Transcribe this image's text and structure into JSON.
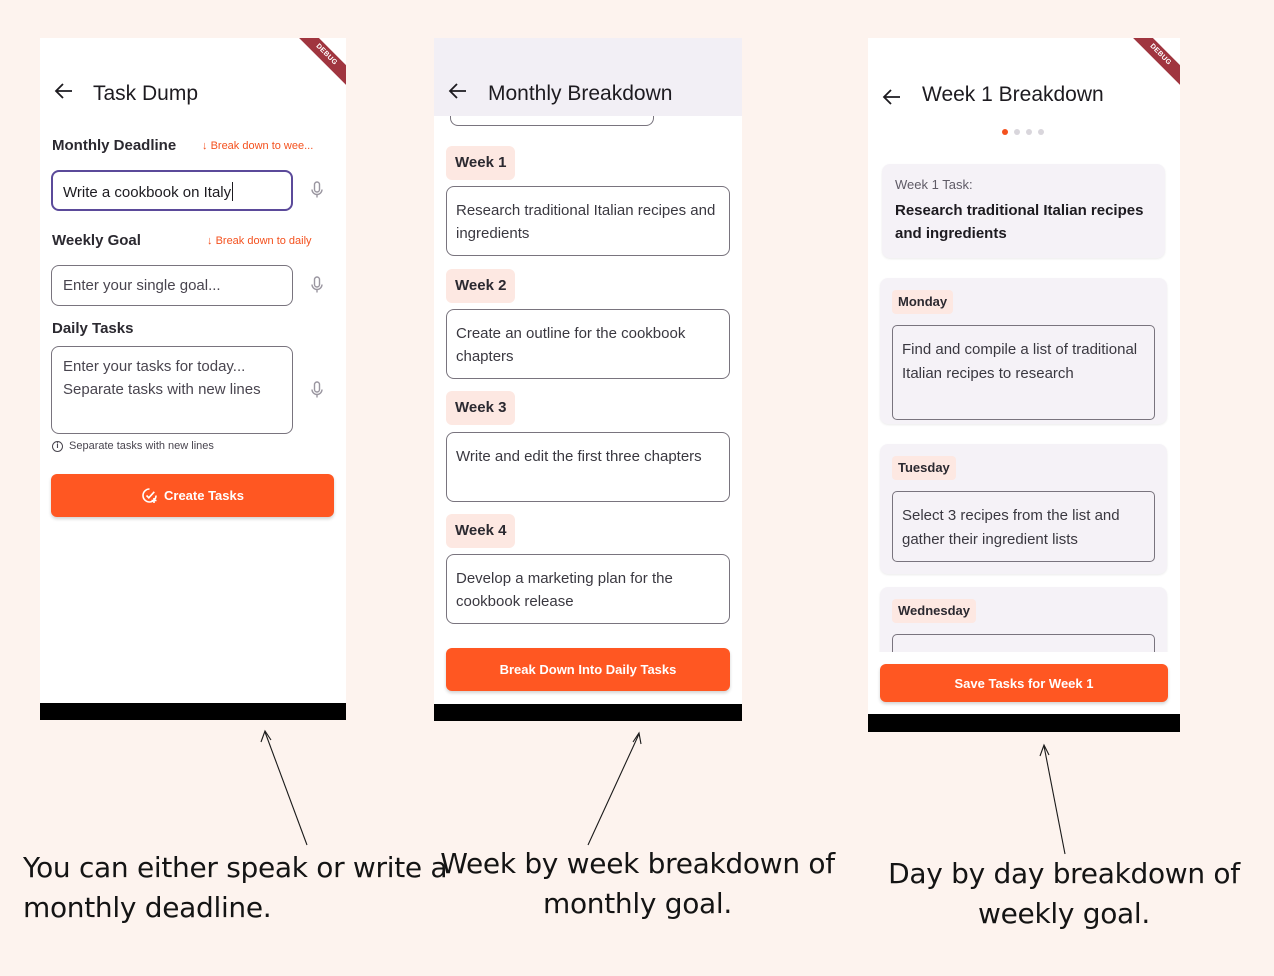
{
  "debug_banner": "DEBUG",
  "screen1": {
    "title": "Task Dump",
    "monthly_label": "Monthly Deadline",
    "monthly_link": "Break down to wee...",
    "monthly_value": "Write a cookbook on Italy",
    "weekly_label": "Weekly Goal",
    "weekly_link": "Break down to daily",
    "weekly_placeholder": "Enter your single goal...",
    "daily_label": "Daily Tasks",
    "daily_placeholder_line1": "Enter your tasks for today...",
    "daily_placeholder_line2": "Separate tasks with new lines",
    "hint": "Separate tasks with new lines",
    "button": "Create Tasks"
  },
  "screen2": {
    "title": "Monthly Breakdown",
    "weeks": [
      {
        "label": "Week 1",
        "task": "Research traditional Italian recipes and ingredients"
      },
      {
        "label": "Week 2",
        "task": "Create an outline for the cookbook chapters"
      },
      {
        "label": "Week 3",
        "task": "Write and edit the first three chapters"
      },
      {
        "label": "Week 4",
        "task": "Develop a marketing plan for the cookbook release"
      }
    ],
    "button": "Break Down Into Daily Tasks"
  },
  "screen3": {
    "title": "Week 1 Breakdown",
    "page_count": 4,
    "active_page": 1,
    "task_label": "Week 1 Task:",
    "task_text": "Research traditional Italian recipes and ingredients",
    "days": [
      {
        "day": "Monday",
        "task": "Find and compile a list of traditional Italian recipes to research"
      },
      {
        "day": "Tuesday",
        "task": "Select 3 recipes from the list and gather their ingredient lists"
      },
      {
        "day": "Wednesday",
        "task": ""
      }
    ],
    "button": "Save Tasks for Week 1"
  },
  "captions": {
    "left": [
      "You can either speak or write a",
      "monthly deadline."
    ],
    "middle": [
      "Week by week breakdown of",
      "monthly goal."
    ],
    "right": [
      "Day by day breakdown of",
      "weekly goal."
    ]
  },
  "colors": {
    "accent": "#ff5722",
    "chip_bg": "#fde8e2",
    "focus_border": "#5b4a9a",
    "page_bg": "#fdf3ee"
  }
}
